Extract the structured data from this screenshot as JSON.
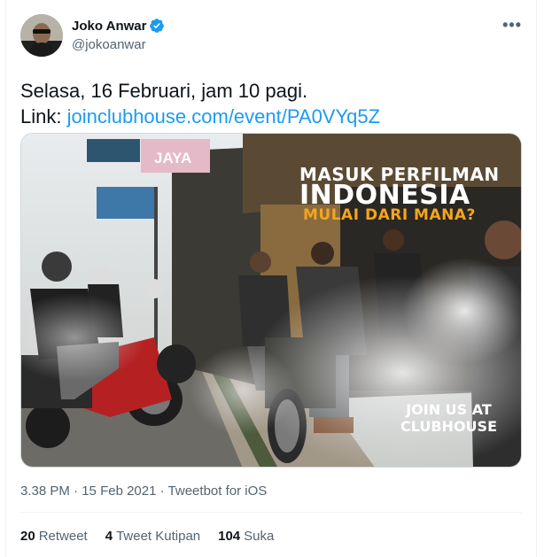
{
  "author": {
    "display_name": "Joko Anwar",
    "handle": "@jokoanwar"
  },
  "tweet": {
    "line1": "Selasa, 16 Februari, jam 10 pagi.",
    "link_prefix": "Link: ",
    "link_text": "joinclubhouse.com/event/PA0VYq5Z"
  },
  "media": {
    "headline_small": "MASUK PERFILMAN",
    "headline_big": "INDONESIA",
    "subheadline": "MULAI DARI MANA?",
    "cta_line1": "JOIN US AT",
    "cta_line2": "CLUBHOUSE",
    "shop_sign": "JAYA"
  },
  "meta": {
    "time": "3.38 PM",
    "separator": "·",
    "date": "15 Feb 2021",
    "source": "Tweetbot for iOS"
  },
  "stats": {
    "retweets_count": "20",
    "retweets_label": "Retweet",
    "quotes_count": "4",
    "quotes_label": "Tweet Kutipan",
    "likes_count": "104",
    "likes_label": "Suka"
  },
  "colors": {
    "link": "#1d9bf0",
    "verified": "#1d9bf0",
    "accent_orange": "#f4a51c"
  },
  "icons": [
    "verified-badge-icon",
    "more-options-icon"
  ]
}
